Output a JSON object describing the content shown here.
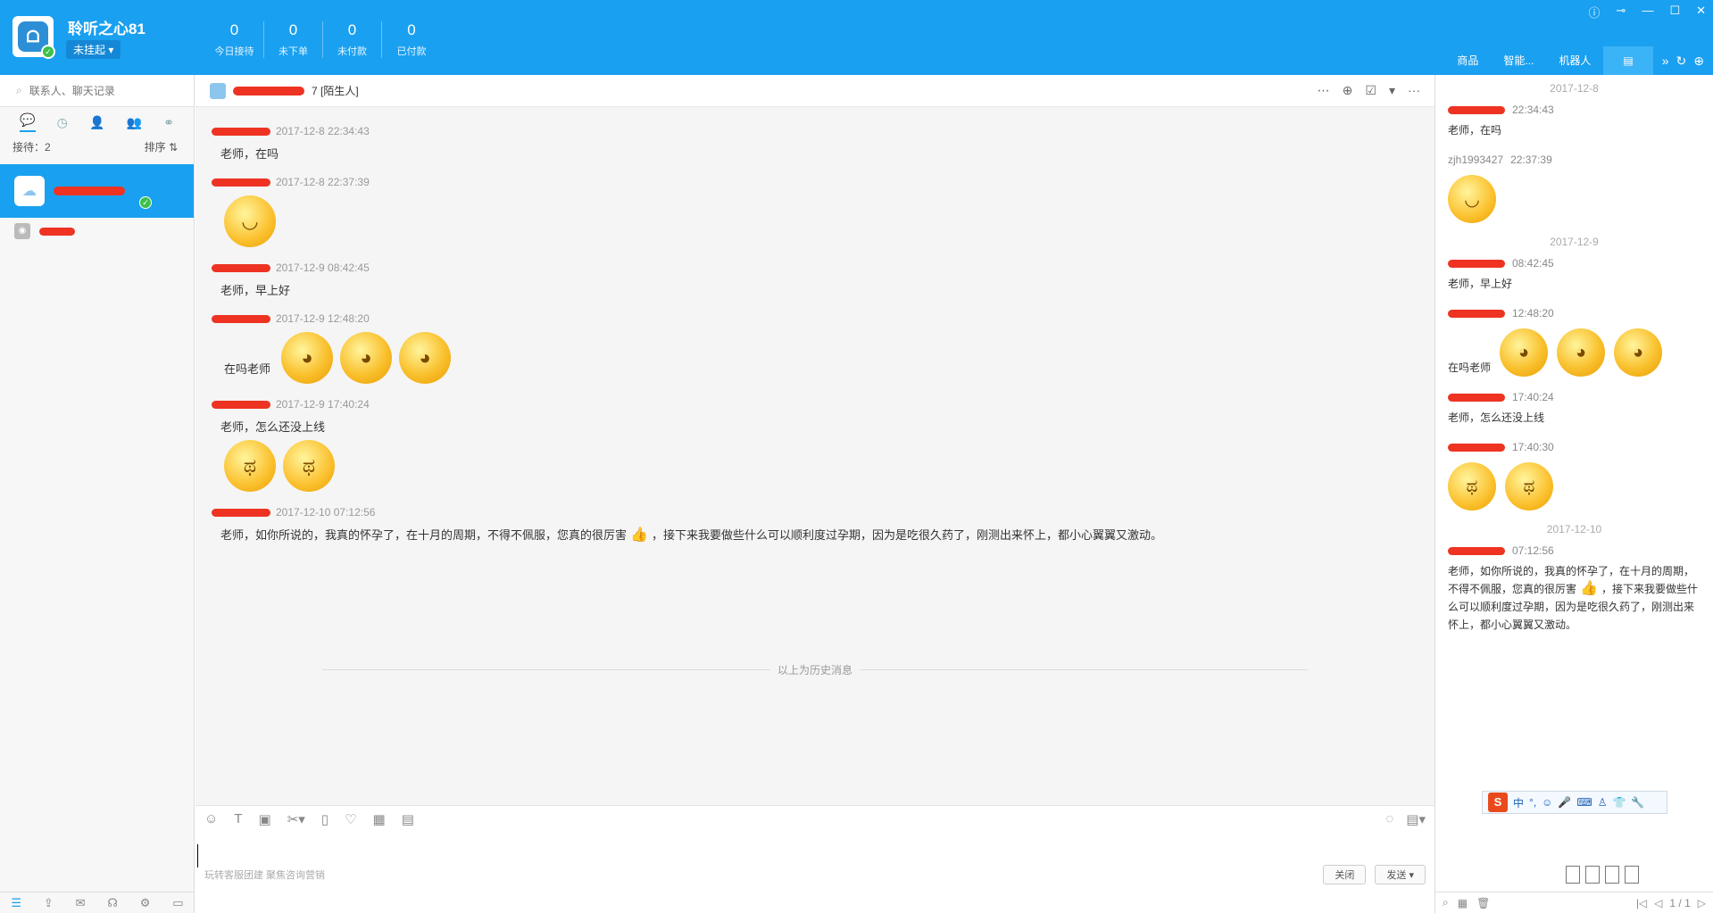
{
  "header": {
    "shop_name": "聆听之心81",
    "status": "未挂起 ▾",
    "stats": [
      {
        "value": "0",
        "label": "今日接待"
      },
      {
        "value": "0",
        "label": "未下单"
      },
      {
        "value": "0",
        "label": "未付款"
      },
      {
        "value": "0",
        "label": "已付款"
      }
    ],
    "right_tabs": [
      "商品",
      "智能...",
      "机器人"
    ]
  },
  "sidebar": {
    "search_placeholder": "联系人、聊天记录",
    "receiving_label": "接待：2",
    "sort_label": "排序 ⇅"
  },
  "chat": {
    "contact_suffix": "7 [陌生人]",
    "messages": [
      {
        "time": "2017-12-8 22:34:43",
        "text": "老师，在吗"
      },
      {
        "time": "2017-12-8 22:37:39"
      },
      {
        "time": "2017-12-9 08:42:45",
        "text": "老师，早上好"
      },
      {
        "time": "2017-12-9 12:48:20",
        "text": "在吗老师"
      },
      {
        "time": "2017-12-9 17:40:24",
        "text": "老师，怎么还没上线"
      },
      {
        "time": "2017-12-10 07:12:56",
        "text_a": "老师，如你所说的，我真的怀孕了，在十月的周期，不得不佩服，您真的很厉害",
        "text_b": "，接下来我要做些什么可以顺利度过孕期，因为是吃很久药了，刚测出来怀上，都小心翼翼又激动。"
      }
    ],
    "history_label": "以上为历史消息",
    "input_hint": "玩转客服团建 聚焦咨询营销",
    "close_button": "关闭",
    "send_button": "发送 ▾"
  },
  "history_panel": {
    "date_1": "2017-12-8",
    "date_2": "2017-12-9",
    "date_3": "2017-12-10",
    "items": [
      {
        "time": "22:34:43",
        "text": "老师，在吗"
      },
      {
        "name": "zjh1993427",
        "time": "22:37:39"
      },
      {
        "time": "08:42:45",
        "text": "老师，早上好"
      },
      {
        "time": "12:48:20",
        "text": "在吗老师"
      },
      {
        "time": "17:40:24",
        "text": "老师，怎么还没上线"
      },
      {
        "time": "17:40:30"
      },
      {
        "time": "07:12:56",
        "text_a": "老师，如你所说的，我真的怀孕了，在十月的周期，不得不佩服，您真的很厉害",
        "text_b": "，接下来我要做些什么可以顺利度过孕期，因为是吃很久药了，刚测出来怀上，都小心翼翼又激动。"
      }
    ],
    "ime_logo": "S",
    "ime_mode": "中",
    "pager": "1 / 1"
  }
}
